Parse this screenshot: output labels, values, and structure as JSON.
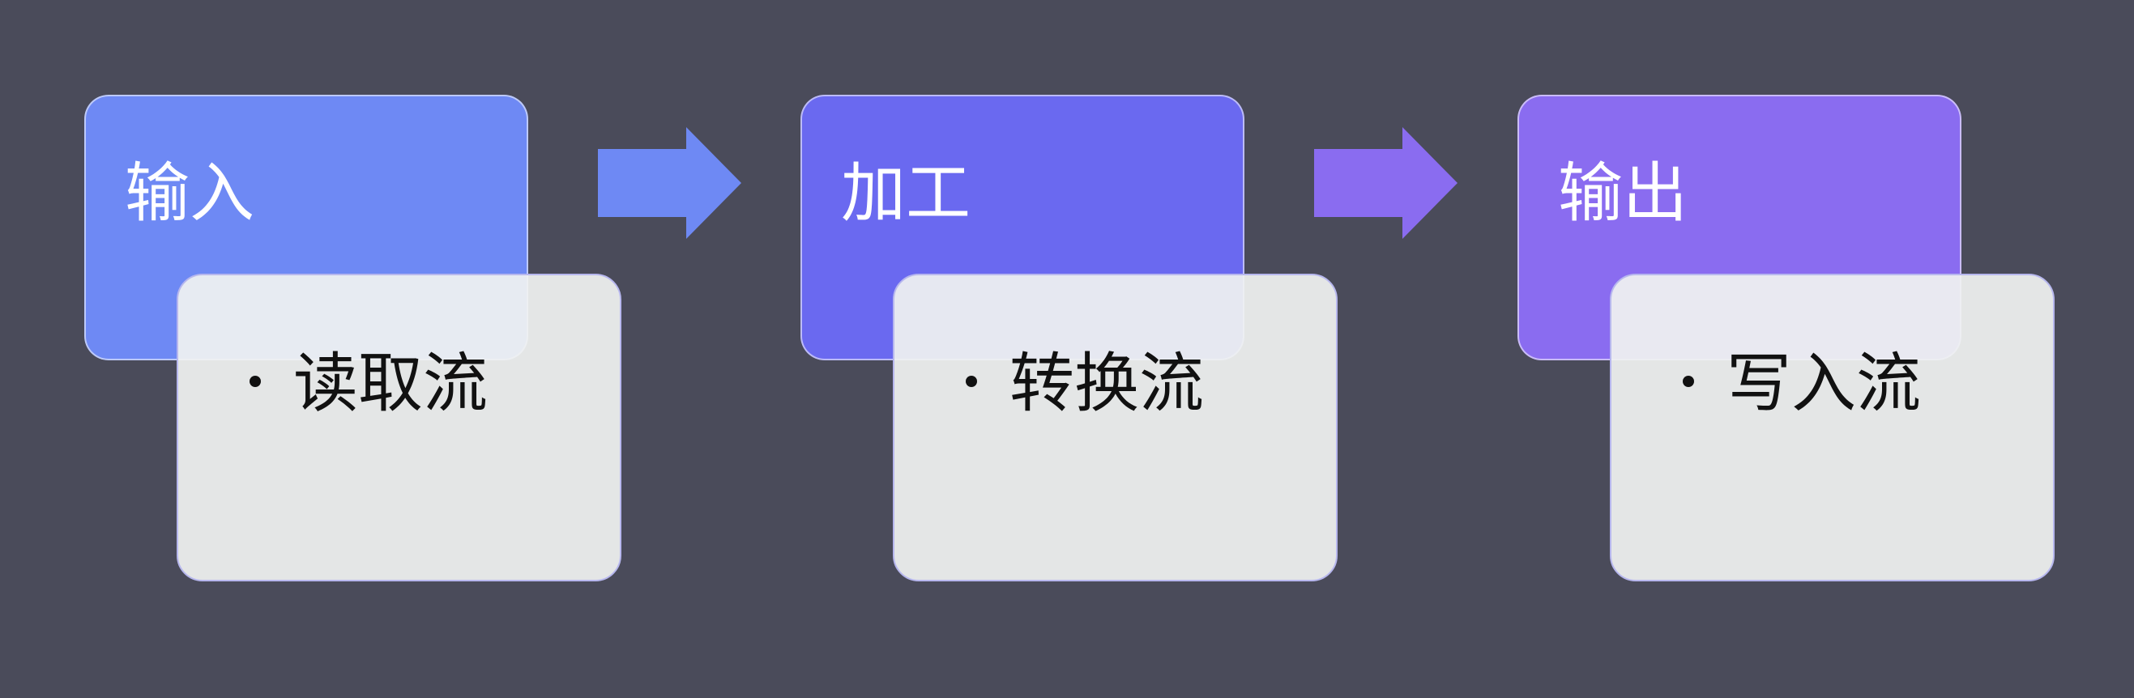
{
  "colors": {
    "background": "#4a4b5a",
    "stage_1": "#6e89f4",
    "stage_2": "#6a69f0",
    "stage_3": "#8a6cf0",
    "arrow_1": "#6e89f4",
    "arrow_2": "#8a6cf0",
    "detail_card": "#eff1f0",
    "detail_border": "#b7b7ee"
  },
  "stages": [
    {
      "title": "输入",
      "item": "读取流",
      "icon": "bullet-dot"
    },
    {
      "title": "加工",
      "item": "转换流",
      "icon": "bullet-dot"
    },
    {
      "title": "输出",
      "item": "写入流",
      "icon": "bullet-dot"
    }
  ],
  "connectors": [
    {
      "icon": "right-arrow-icon"
    },
    {
      "icon": "right-arrow-icon"
    }
  ]
}
